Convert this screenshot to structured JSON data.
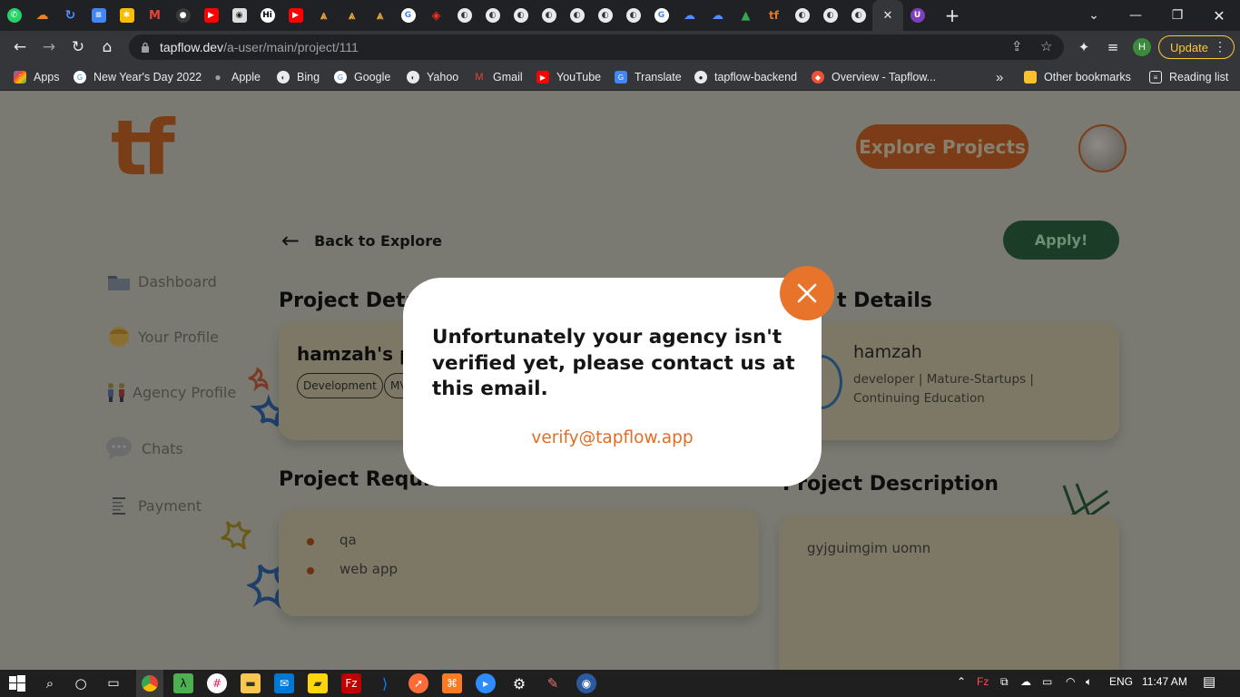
{
  "browser": {
    "url_host": "tapflow.dev",
    "url_path": "/a-user/main/project/111",
    "update_label": "Update",
    "profile_initial": "H"
  },
  "bookmarks": [
    {
      "label": "Apps",
      "icon": "apps-grid-icon",
      "color": "#4285f4"
    },
    {
      "label": "New Year's Day 2022",
      "icon": "google-icon",
      "color": "#ffffff"
    },
    {
      "label": "Apple",
      "icon": "apple-icon",
      "color": "#9aa0a6"
    },
    {
      "label": "Bing",
      "icon": "globe-icon",
      "color": "#e8eaed"
    },
    {
      "label": "Google",
      "icon": "google-icon",
      "color": "#ffffff"
    },
    {
      "label": "Yahoo",
      "icon": "globe-icon",
      "color": "#e8eaed"
    },
    {
      "label": "Gmail",
      "icon": "gmail-icon",
      "color": "#ea4335"
    },
    {
      "label": "YouTube",
      "icon": "youtube-icon",
      "color": "#ff0000"
    },
    {
      "label": "Translate",
      "icon": "translate-icon",
      "color": "#4285f4"
    },
    {
      "label": "tapflow-backend",
      "icon": "github-icon",
      "color": "#e8eaed"
    },
    {
      "label": "Overview - Tapflow...",
      "icon": "tapflow-icon",
      "color": "#f05033"
    }
  ],
  "bookmarks_right": {
    "more": "»",
    "other": "Other bookmarks",
    "reading": "Reading list"
  },
  "app": {
    "logo": "tf",
    "explore_button": "Explore Projects",
    "back_label": "Back to Explore",
    "apply_button": "Apply!",
    "sidebar": [
      {
        "label": "Dashboard",
        "icon": "folder-icon"
      },
      {
        "label": "Your Profile",
        "icon": "person-icon"
      },
      {
        "label": "Agency Profile",
        "icon": "people-icon"
      },
      {
        "label": "Chats",
        "icon": "speech-bubble-icon"
      },
      {
        "label": "Payment",
        "icon": "receipt-icon"
      }
    ],
    "project_details_title": "Project Detai",
    "project_name": "hamzah's p",
    "tags": [
      "Development",
      "MV"
    ],
    "client_details_title": "t Details",
    "client_name": "hamzah",
    "client_info": "developer | Mature-Startups | Continuing Education",
    "requirements_title": "Project Requirements",
    "requirements": [
      "qa",
      "web app"
    ],
    "description_title": "Project Description",
    "description": "gyjguimɡim uomn"
  },
  "modal": {
    "message": "Unfortunately your agency isn't verified yet, please contact us at this email.",
    "email": "verify@tapflow.app"
  },
  "taskbar": {
    "lang": "ENG",
    "time": "11:47 AM"
  },
  "colors": {
    "accent_orange": "#e8742c",
    "brand_brown": "#7b3c17",
    "apply_green": "#1b3d27",
    "email_orange": "#e06d25"
  }
}
